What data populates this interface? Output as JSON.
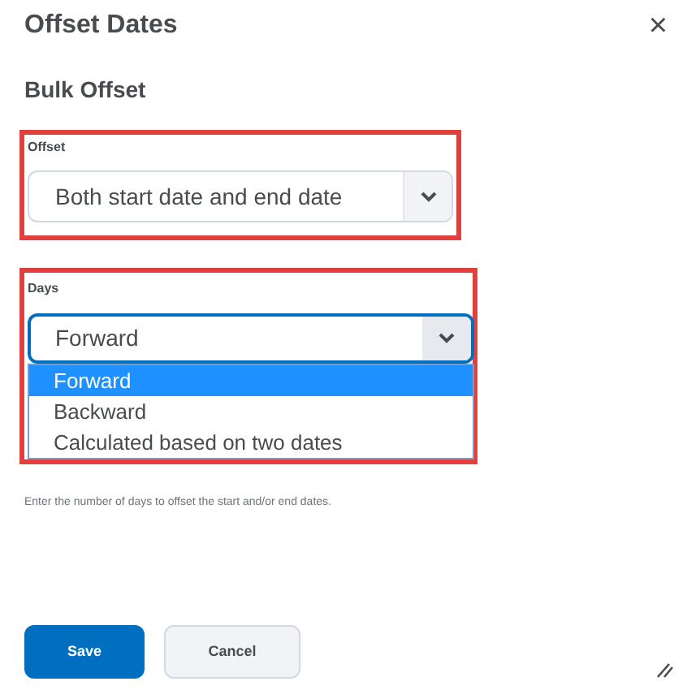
{
  "dialog": {
    "title": "Offset Dates",
    "close": "×"
  },
  "section_title": "Bulk Offset",
  "offset_field": {
    "label": "Offset",
    "value": "Both start date and end date"
  },
  "days_field": {
    "label": "Days",
    "value": "Forward",
    "expanded": true,
    "options": [
      {
        "label": "Forward",
        "selected": true
      },
      {
        "label": "Backward",
        "selected": false
      },
      {
        "label": "Calculated based on two dates",
        "selected": false
      }
    ],
    "hint": "Enter the number of days to offset the start and/or end dates."
  },
  "buttons": [
    {
      "label": "Save",
      "kind": "primary"
    },
    {
      "label": "Cancel",
      "kind": "secondary"
    }
  ]
}
